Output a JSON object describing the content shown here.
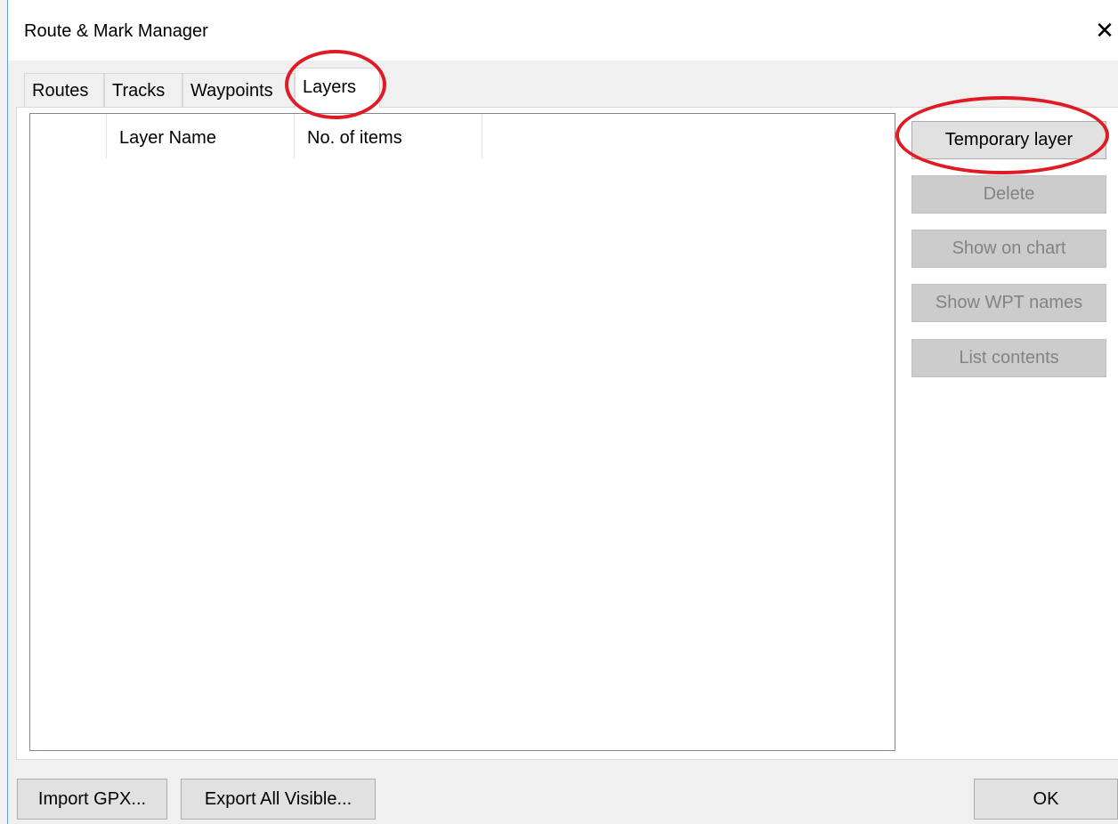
{
  "window": {
    "title": "Route & Mark Manager",
    "close_glyph": "✕"
  },
  "tabs": [
    {
      "label": "Routes",
      "active": false
    },
    {
      "label": "Tracks",
      "active": false
    },
    {
      "label": "Waypoints",
      "active": false
    },
    {
      "label": "Layers",
      "active": true
    }
  ],
  "list": {
    "columns": [
      "",
      "Layer Name",
      "No. of items"
    ],
    "rows": []
  },
  "side_buttons": [
    {
      "label": "Temporary layer",
      "enabled": true
    },
    {
      "label": "Delete",
      "enabled": false
    },
    {
      "label": "Show on chart",
      "enabled": false
    },
    {
      "label": "Show WPT names",
      "enabled": false
    },
    {
      "label": "List contents",
      "enabled": false
    }
  ],
  "bottom_buttons": {
    "import": "Import GPX...",
    "export": "Export All Visible...",
    "ok": "OK"
  },
  "colors": {
    "accent_edge": "#5fa0d9",
    "annotation": "#e01b24",
    "disabled_text": "#838383"
  }
}
